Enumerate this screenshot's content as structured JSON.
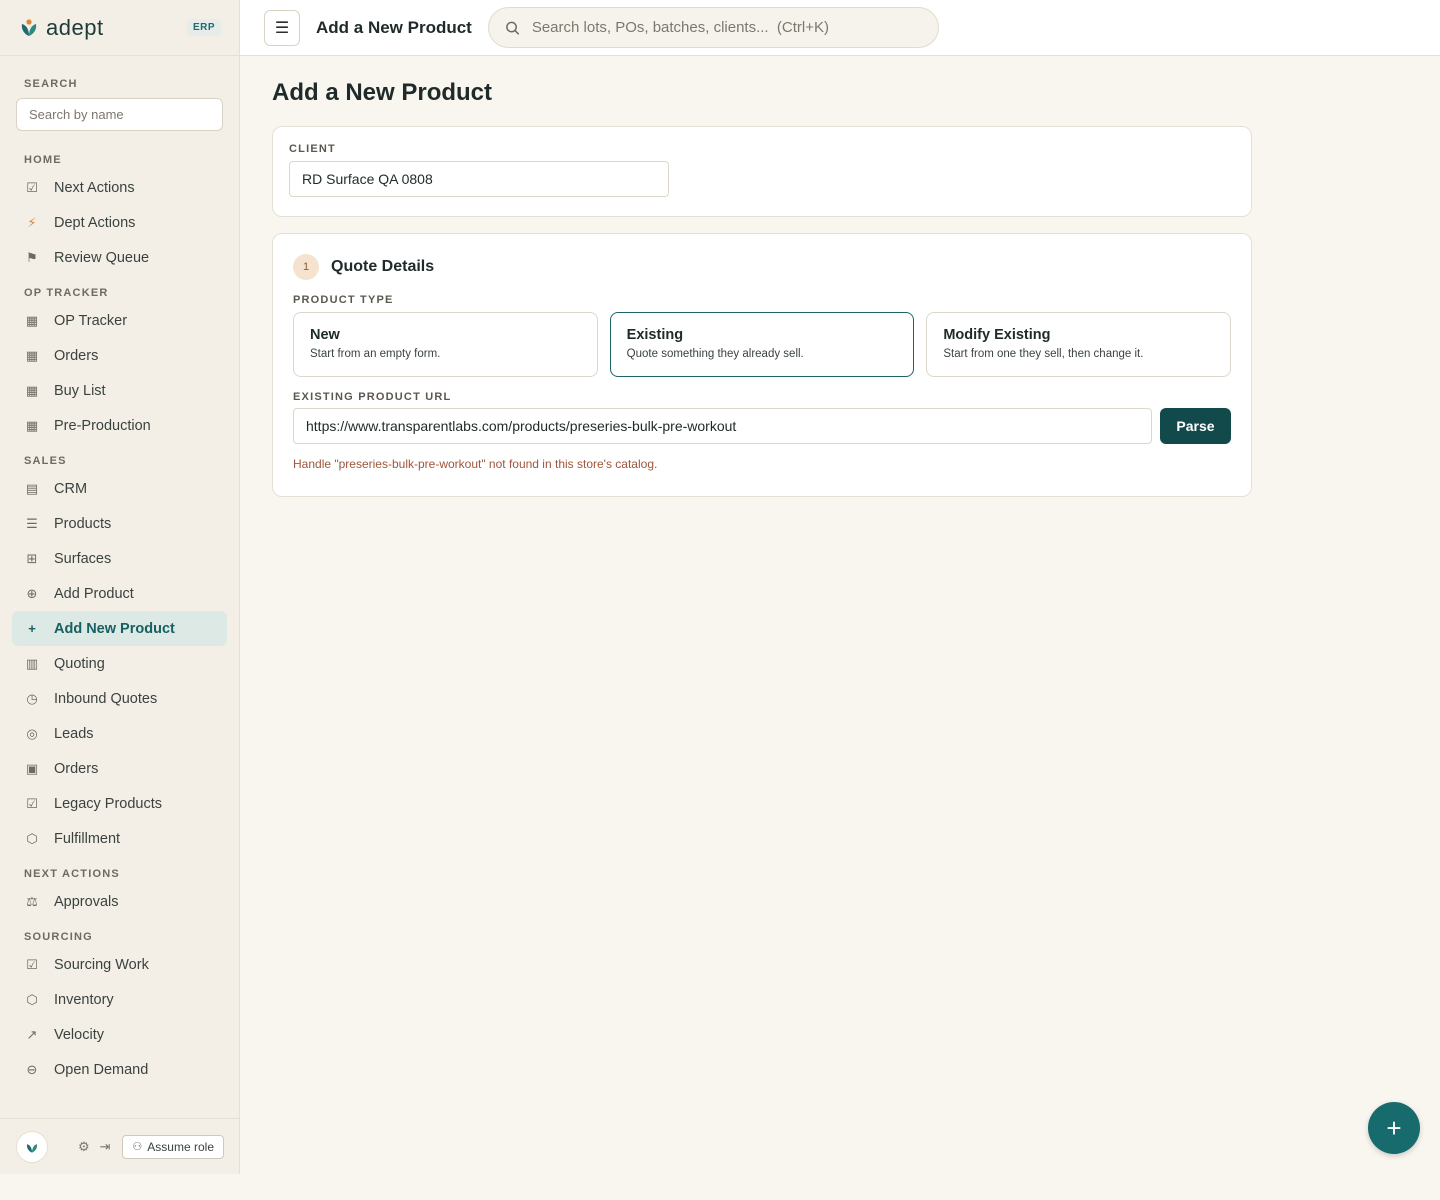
{
  "brand": {
    "name": "adept",
    "tag": "ERP"
  },
  "sidebar": {
    "search_label": "SEARCH",
    "search_placeholder": "Search by name",
    "sections": [
      {
        "label": "HOME",
        "items": [
          {
            "label": "Next Actions",
            "icon": "check-square-icon",
            "glyph": "☑"
          },
          {
            "label": "Dept Actions",
            "icon": "lightning-icon",
            "glyph": "⚡"
          },
          {
            "label": "Review Queue",
            "icon": "flag-icon",
            "glyph": "⚑"
          }
        ]
      },
      {
        "label": "OP TRACKER",
        "items": [
          {
            "label": "OP Tracker",
            "icon": "table-icon",
            "glyph": "▦"
          },
          {
            "label": "Orders",
            "icon": "table-icon",
            "glyph": "▦"
          },
          {
            "label": "Buy List",
            "icon": "table-icon",
            "glyph": "▦"
          },
          {
            "label": "Pre-Production",
            "icon": "table-icon",
            "glyph": "▦"
          }
        ]
      },
      {
        "label": "SALES",
        "items": [
          {
            "label": "CRM",
            "icon": "contact-card-icon",
            "glyph": "▤"
          },
          {
            "label": "Products",
            "icon": "list-icon",
            "glyph": "☰"
          },
          {
            "label": "Surfaces",
            "icon": "grid-icon",
            "glyph": "⊞"
          },
          {
            "label": "Add Product",
            "icon": "plus-circle-icon",
            "glyph": "⊕"
          },
          {
            "label": "Add New Product",
            "icon": "plus-icon",
            "glyph": "+",
            "active": true
          },
          {
            "label": "Quoting",
            "icon": "calculator-icon",
            "glyph": "▥"
          },
          {
            "label": "Inbound Quotes",
            "icon": "clock-icon",
            "glyph": "◷"
          },
          {
            "label": "Leads",
            "icon": "target-icon",
            "glyph": "◎"
          },
          {
            "label": "Orders",
            "icon": "clipboard-icon",
            "glyph": "▣"
          },
          {
            "label": "Legacy Products",
            "icon": "check-square-icon",
            "glyph": "☑"
          },
          {
            "label": "Fulfillment",
            "icon": "package-icon",
            "glyph": "⬡"
          }
        ]
      },
      {
        "label": "NEXT ACTIONS",
        "items": [
          {
            "label": "Approvals",
            "icon": "scale-icon",
            "glyph": "⚖"
          }
        ]
      },
      {
        "label": "SOURCING",
        "items": [
          {
            "label": "Sourcing Work",
            "icon": "check-square-icon",
            "glyph": "☑"
          },
          {
            "label": "Inventory",
            "icon": "box-icon",
            "glyph": "⬡"
          },
          {
            "label": "Velocity",
            "icon": "trend-up-icon",
            "glyph": "↗"
          },
          {
            "label": "Open Demand",
            "icon": "minus-circle-icon",
            "glyph": "⊖"
          }
        ]
      }
    ],
    "footer": {
      "assume_role": "Assume role"
    }
  },
  "topbar": {
    "title": "Add a New Product",
    "search_placeholder": "Search lots, POs, batches, clients...  (Ctrl+K)"
  },
  "main": {
    "page_title": "Add a New Product",
    "client": {
      "label": "CLIENT",
      "value": "RD Surface QA 0808"
    },
    "quote": {
      "step": "1",
      "title": "Quote Details",
      "product_type_label": "PRODUCT TYPE",
      "types": [
        {
          "title": "New",
          "desc": "Start from an empty form."
        },
        {
          "title": "Existing",
          "desc": "Quote something they already sell.",
          "selected": true
        },
        {
          "title": "Modify Existing",
          "desc": "Start from one they sell, then change it."
        }
      ],
      "url_label": "EXISTING PRODUCT URL",
      "url_value": "https://www.transparentlabs.com/products/preseries-bulk-pre-workout",
      "parse_label": "Parse",
      "error": "Handle \"preseries-bulk-pre-workout\" not found in this store's catalog."
    }
  },
  "fab": {
    "label": "+"
  },
  "colors": {
    "accent": "#176b6d",
    "parse_button": "#124a4b",
    "error": "#a0553a",
    "active_nav_bg": "#dde9e5"
  }
}
